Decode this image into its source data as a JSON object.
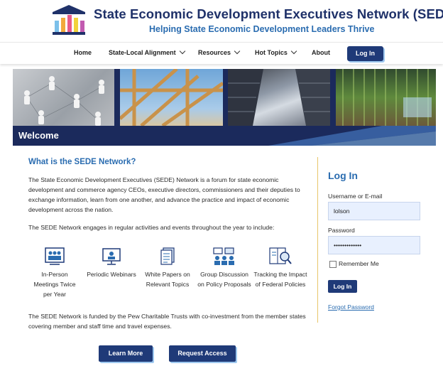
{
  "header": {
    "title": "State Economic Development Executives Network (SEDE)",
    "tagline": "Helping State Economic Development Leaders Thrive"
  },
  "nav": {
    "items": [
      {
        "label": "Home",
        "has_dropdown": false
      },
      {
        "label": "State-Local Alignment",
        "has_dropdown": true
      },
      {
        "label": "Resources",
        "has_dropdown": true
      },
      {
        "label": "Hot Topics",
        "has_dropdown": true
      },
      {
        "label": "About",
        "has_dropdown": false
      }
    ],
    "login_label": "Log In"
  },
  "banner": {
    "welcome": "Welcome"
  },
  "main": {
    "heading": "What is the SEDE Network?",
    "intro": "The State Economic Development Executives (SEDE) Network is a forum for state economic development and commerce agency CEOs, executive directors, commissioners and their deputies to exchange information, learn from one another, and advance the practice and impact of economic development across the nation.",
    "engages": "The SEDE Network engages in regular activities and events throughout the year to include:",
    "activities": [
      {
        "label": "In-Person Meetings Twice per Year",
        "icon": "meeting-icon"
      },
      {
        "label": "Periodic Webinars",
        "icon": "webinar-icon"
      },
      {
        "label": "White Papers on Relevant Topics",
        "icon": "document-icon"
      },
      {
        "label": "Group Discussion on Policy Proposals",
        "icon": "group-discussion-icon"
      },
      {
        "label": "Tracking the Impact of Federal Policies",
        "icon": "tracking-icon"
      }
    ],
    "funding": "The SEDE Network is funded by the Pew Charitable Trusts with co-investment from the member states covering member and staff time and travel expenses.",
    "learn_more": "Learn More",
    "request_access": "Request Access"
  },
  "login": {
    "title": "Log In",
    "username_label": "Username or E-mail",
    "username_value": "lolson",
    "password_label": "Password",
    "password_value": "•••••••••••••",
    "remember_label": "Remember Me",
    "remember_checked": false,
    "submit_label": "Log In",
    "forgot_label": "Forgot Password"
  },
  "colors": {
    "navy": "#1f3a78",
    "accent_blue": "#2a6cb0",
    "title_navy": "#1f3169",
    "divider_gold": "#e8c66a"
  }
}
